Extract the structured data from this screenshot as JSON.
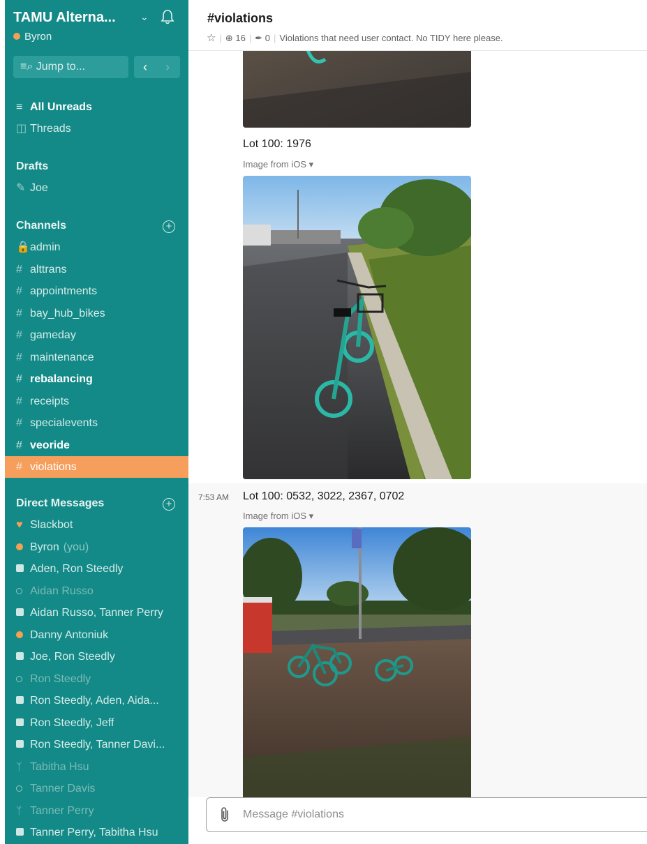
{
  "sidebar": {
    "team_name": "TAMU Alterna...",
    "user_name": "Byron",
    "jump_to": "Jump to...",
    "nav": [
      {
        "label": "All Unreads",
        "bold": true
      },
      {
        "label": "Threads"
      }
    ],
    "drafts_header": "Drafts",
    "drafts": [
      {
        "label": "Joe"
      }
    ],
    "channels_header": "Channels",
    "channels": [
      {
        "label": "admin",
        "private": true
      },
      {
        "label": "alttrans"
      },
      {
        "label": "appointments"
      },
      {
        "label": "bay_hub_bikes"
      },
      {
        "label": "gameday"
      },
      {
        "label": "maintenance"
      },
      {
        "label": "rebalancing",
        "bold": true
      },
      {
        "label": "receipts"
      },
      {
        "label": "specialevents"
      },
      {
        "label": "veoride",
        "bold": true
      },
      {
        "label": "violations",
        "active": true
      }
    ],
    "dm_header": "Direct Messages",
    "dms": [
      {
        "label": "Slackbot",
        "icon": "heart"
      },
      {
        "label": "Byron",
        "suffix": "(you)",
        "icon": "online"
      },
      {
        "label": "Aden, Ron Steedly",
        "icon": "group"
      },
      {
        "label": "Aidan Russo",
        "icon": "away"
      },
      {
        "label": "Aidan Russo, Tanner Perry",
        "icon": "group"
      },
      {
        "label": "Danny Antoniuk",
        "icon": "online"
      },
      {
        "label": "Joe, Ron Steedly",
        "icon": "group"
      },
      {
        "label": "Ron Steedly",
        "icon": "away"
      },
      {
        "label": "Ron Steedly, Aden, Aida...",
        "icon": "group"
      },
      {
        "label": "Ron Steedly, Jeff",
        "icon": "group"
      },
      {
        "label": "Ron Steedly, Tanner Davi...",
        "icon": "group"
      },
      {
        "label": "Tabitha Hsu",
        "icon": "guest"
      },
      {
        "label": "Tanner Davis",
        "icon": "away"
      },
      {
        "label": "Tanner Perry",
        "icon": "guest"
      },
      {
        "label": "Tanner Perry, Tabitha Hsu",
        "icon": "group"
      }
    ]
  },
  "channel": {
    "name": "#violations",
    "members": "16",
    "pins": "0",
    "topic": "Violations that need user contact.  No TIDY here please."
  },
  "messages": [
    {
      "time": "",
      "text": "Lot 100: 1976",
      "image_label": "Image from iOS"
    },
    {
      "time": "7:53 AM",
      "text": "Lot 100: 0532, 3022, 2367, 0702",
      "image_label": "Image from iOS"
    }
  ],
  "composer": {
    "placeholder": "Message #violations"
  },
  "colors": {
    "sidebar": "#138a87",
    "active": "#f69e5b",
    "presence": "#f3a155"
  }
}
